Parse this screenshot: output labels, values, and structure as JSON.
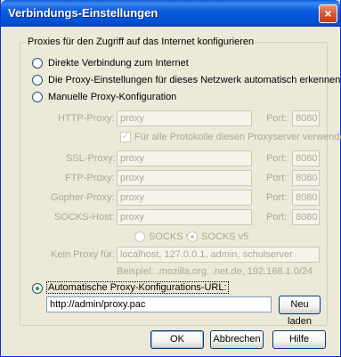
{
  "window": {
    "title": "Verbindungs-Einstellungen",
    "close_label": "×"
  },
  "group": {
    "legend": "Proxies für den Zugriff auf das Internet konfigurieren"
  },
  "options": {
    "direct": "Direkte Verbindung zum Internet",
    "autodetect": "Die Proxy-Einstellungen für dieses Netzwerk automatisch erkennen",
    "manual": "Manuelle Proxy-Konfiguration",
    "auto_url": "Automatische Proxy-Konfigurations-URL:"
  },
  "manual": {
    "port_label": "Port:",
    "http": {
      "label": "HTTP-Proxy:",
      "value": "proxy",
      "port": "8080"
    },
    "share_all": "Für alle Protokolle diesen Proxyserver verwenden",
    "ssl": {
      "label": "SSL-Proxy:",
      "value": "proxy",
      "port": "8080"
    },
    "ftp": {
      "label": "FTP-Proxy:",
      "value": "proxy",
      "port": "8080"
    },
    "gopher": {
      "label": "Gopher-Proxy:",
      "value": "proxy",
      "port": "8080"
    },
    "socks": {
      "label": "SOCKS-Host:",
      "value": "proxy",
      "port": "8080"
    },
    "socks_v4": "SOCKS v4",
    "socks_v5": "SOCKS v5",
    "no_proxy_label": "Kein Proxy für:",
    "no_proxy_value": "localhost, 127.0.0.1, admin, schulserver",
    "example": "Beispiel: .mozilla.org, .net.de, 192.168.1.0/24"
  },
  "auto": {
    "url_value": "http://admin/proxy.pac",
    "reload_label": "Neu laden"
  },
  "buttons": {
    "ok": "OK",
    "cancel": "Abbrechen",
    "help": "Hilfe"
  },
  "colors": {
    "titlebar": "#0a5bd8",
    "dialog_bg": "#ece9d8",
    "radio_selected": "#21a121",
    "close_button": "#d9572e"
  }
}
